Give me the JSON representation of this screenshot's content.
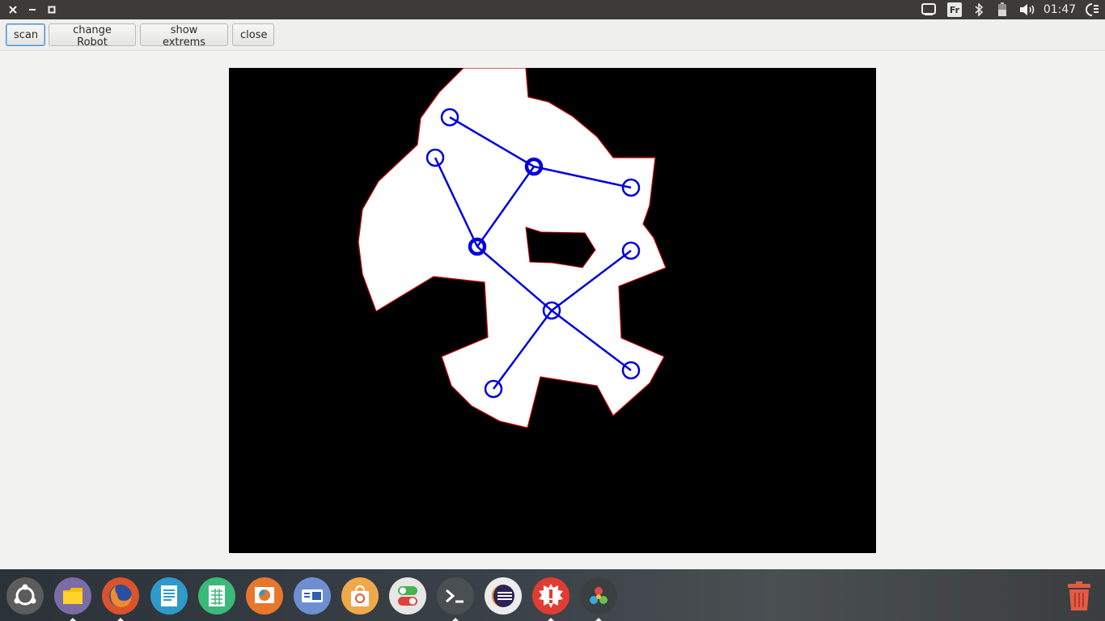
{
  "window": {
    "controls": [
      "close-icon",
      "minimize-icon",
      "maximize-icon"
    ]
  },
  "tray": {
    "icons": [
      "screen-icon",
      "keyboard-layout-icon",
      "bluetooth-icon",
      "battery-icon",
      "volume-icon",
      "session-icon"
    ],
    "keyboard_layout": "Fr",
    "clock": "01:47"
  },
  "toolbar": {
    "scan_label": "scan",
    "change_robot_label": "change Robot",
    "show_extrems_label": "show extrems",
    "close_label": "close"
  },
  "map": {
    "background": "#000000",
    "free_space_color": "#ffffff",
    "obstacle_edge_color": "#cc0000",
    "graph_color": "#0000dd"
  },
  "dock": {
    "apps": [
      {
        "name": "ubuntu-home-icon",
        "color": "#6e6e6e"
      },
      {
        "name": "files-icon",
        "color": "#7b6ca6"
      },
      {
        "name": "firefox-icon",
        "color": "#d9532c"
      },
      {
        "name": "text-editor-icon",
        "color": "#2f99c9"
      },
      {
        "name": "spreadsheet-icon",
        "color": "#3cb878"
      },
      {
        "name": "presentation-icon",
        "color": "#e8762d"
      },
      {
        "name": "software-icon",
        "color": "#6d8fd1"
      },
      {
        "name": "store-icon",
        "color": "#f0a84a"
      },
      {
        "name": "settings-toggle-icon",
        "color": "#e6e6e6"
      },
      {
        "name": "terminal-icon",
        "color": "#4a4f52"
      },
      {
        "name": "eclipse-icon",
        "color": "#ececec"
      },
      {
        "name": "alert-app-icon",
        "color": "#e03c31"
      },
      {
        "name": "robot-app-icon",
        "color": "#3a3f42"
      }
    ],
    "trash": "trash-icon"
  }
}
